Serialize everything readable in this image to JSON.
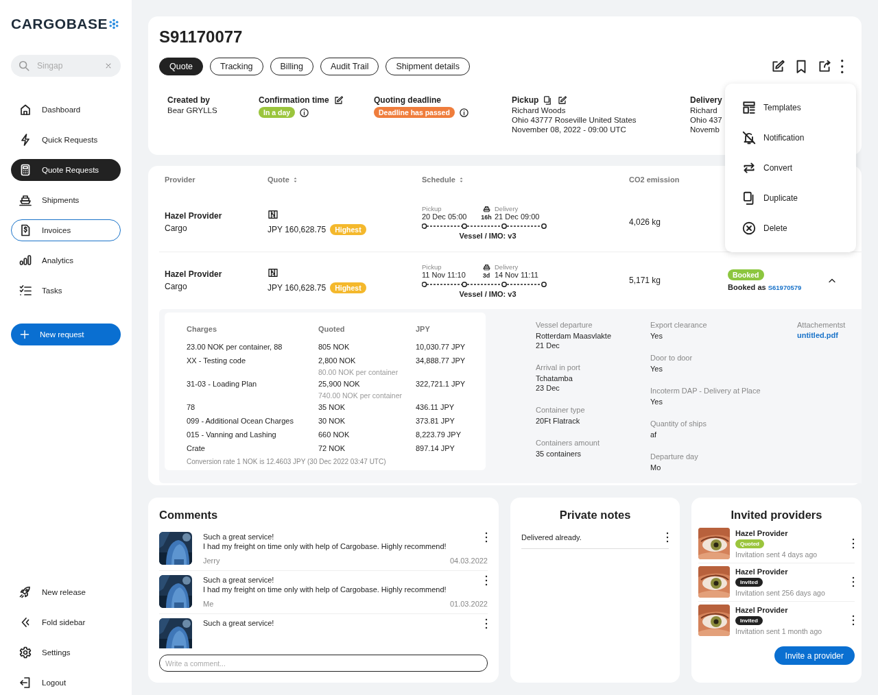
{
  "sidebar": {
    "logo": "CARGOBASE",
    "search": {
      "value": "Singap"
    },
    "items": [
      {
        "label": "Dashboard",
        "selected": false,
        "focused": false
      },
      {
        "label": "Quick Requests",
        "selected": false,
        "focused": false
      },
      {
        "label": "Quote Requests",
        "selected": true,
        "focused": false
      },
      {
        "label": "Shipments",
        "selected": false,
        "focused": false
      },
      {
        "label": "Invoices",
        "selected": false,
        "focused": true
      },
      {
        "label": "Analytics",
        "selected": false,
        "focused": false
      },
      {
        "label": "Tasks",
        "selected": false,
        "focused": false
      }
    ],
    "new_request": "New request",
    "bottom_items": [
      "New release",
      "Fold sidebar",
      "Settings",
      "Logout"
    ]
  },
  "header": {
    "title": "S91170077",
    "tabs": [
      {
        "label": "Quote",
        "selected": true
      },
      {
        "label": "Tracking",
        "selected": false
      },
      {
        "label": "Billing",
        "selected": false
      },
      {
        "label": "Audit Trail",
        "selected": false
      },
      {
        "label": "Shipment details",
        "selected": false
      }
    ],
    "fields": [
      {
        "label": "Created by",
        "lines": [
          "Bear GRYLLS"
        ]
      },
      {
        "label": "Confirmation time",
        "badge": {
          "text": "In a day",
          "color": "#9bc53d"
        }
      },
      {
        "label": "Quoting deadline",
        "badge": {
          "text": "Deadline has passed",
          "color": "#ef7d3c"
        }
      },
      {
        "label": "Pickup",
        "lines": [
          "Richard Woods",
          "Ohio 43777 Roseville United States",
          "November 08, 2022 - 09:00 UTC"
        ]
      },
      {
        "label": "Delivery",
        "lines": [
          "Richard",
          "Ohio 437",
          "Novemb"
        ]
      }
    ]
  },
  "menu": {
    "items": [
      "Templates",
      "Notification",
      "Convert",
      "Duplicate",
      "Delete"
    ]
  },
  "quotes": {
    "columns": [
      {
        "label": "Provider",
        "sortable": false
      },
      {
        "label": "Quote",
        "sortable": true
      },
      {
        "label": "Schedule",
        "sortable": true
      },
      {
        "label": "CO2 emission",
        "sortable": false
      }
    ],
    "rows": [
      {
        "provider": "Hazel Provider",
        "type": "Cargo",
        "price": "JPY 160,628.75",
        "badge": {
          "text": "Highest",
          "color": "#f4b82c"
        },
        "pickup_label": "Pickup",
        "pickup": "20 Dec 05:00",
        "duration": "16h",
        "delivery_label": "Delivery",
        "delivery": "21 Dec 09:00",
        "vessel": "Vessel / IMO: v3",
        "co2": "4,026 kg"
      },
      {
        "provider": "Hazel Provider",
        "type": "Cargo",
        "price": "JPY 160,628.75",
        "badge": {
          "text": "Highest",
          "color": "#f4b82c"
        },
        "pickup_label": "Pickup",
        "pickup": "11 Nov 11:10",
        "duration": "3d",
        "delivery_label": "Delivery",
        "delivery": "14 Nov 11:11",
        "vessel": "Vessel / IMO: v3",
        "co2": "5,171 kg",
        "status": {
          "badge": "Booked",
          "color": "#8cc63f",
          "label": "Booked as",
          "ref": "S61970579"
        },
        "expanded": true
      }
    ],
    "details": {
      "columns": [
        "Charges",
        "Quoted",
        "JPY"
      ],
      "charges": [
        {
          "charge": "23.00 NOK per container, 88",
          "quoted": "805 NOK",
          "jpy": "10,030.77 JPY"
        },
        {
          "charge": "XX - Testing code",
          "quoted": "2,800 NOK",
          "note": "80.00 NOK per container",
          "jpy": "34,888.77 JPY"
        },
        {
          "charge": "31-03 - Loading Plan",
          "quoted": "25,900 NOK",
          "note": "740.00 NOK per container",
          "jpy": "322,721.1 JPY"
        },
        {
          "charge": "78",
          "quoted": "35 NOK",
          "jpy": "436.11 JPY"
        },
        {
          "charge": "099 - Additional Ocean Charges",
          "quoted": "30 NOK",
          "jpy": "373.81 JPY"
        },
        {
          "charge": "015 - Vanning and Lashing",
          "quoted": "660 NOK",
          "jpy": "8,223.79 JPY"
        },
        {
          "charge": "Crate",
          "quoted": "72 NOK",
          "jpy": "897.14 JPY"
        }
      ],
      "conversion": "Conversion rate 1 NOK is 12.4603 JPY (30 Dec 2022 03:47 UTC)",
      "info_columns": [
        [
          {
            "label": "Vessel departure",
            "lines": [
              "Rotterdam Maasvlakte",
              "21 Dec"
            ]
          },
          {
            "label": "Arrival in port",
            "lines": [
              "Tchatamba",
              "23 Dec"
            ]
          },
          {
            "label": "Container type",
            "lines": [
              "20Ft Flatrack"
            ]
          },
          {
            "label": "Containers amount",
            "lines": [
              "35 containers"
            ]
          }
        ],
        [
          {
            "label": "Export clearance",
            "lines": [
              "Yes"
            ]
          },
          {
            "label": "Door to door",
            "lines": [
              "Yes"
            ]
          },
          {
            "label": "Incoterm DAP - Delivery at Place",
            "lines": [
              "Yes"
            ]
          },
          {
            "label": "Quantity of ships",
            "lines": [
              "af"
            ]
          },
          {
            "label": "Departure day",
            "lines": [
              "Mo"
            ]
          }
        ]
      ],
      "attachments": {
        "label": "Attachementst",
        "files": [
          "untitled.pdf"
        ]
      }
    }
  },
  "comments": {
    "title": "Comments",
    "items": [
      {
        "title": "Such a great service!",
        "message": "I had my freight on time only with help of Cargobase. Highly recommend!",
        "author": "Jerry",
        "date": "04.03.2022"
      },
      {
        "title": "Such a great service!",
        "message": "I had my freight on time only with help of Cargobase. Highly recommend!",
        "author": "Me",
        "date": "01.03.2022"
      },
      {
        "title": "Such a great service!"
      }
    ],
    "placeholder": "Write a comment..."
  },
  "notes": {
    "title": "Private notes",
    "items": [
      "Delivered already."
    ]
  },
  "providers": {
    "title": "Invited providers",
    "items": [
      {
        "name": "Hazel Provider",
        "status": "Quoted",
        "color": "#9bc53d",
        "sent": "Invitation sent 4 days ago"
      },
      {
        "name": "Hazel Provider",
        "status": "Invited",
        "color": "#222222",
        "sent": "Invitation sent 256 days ago"
      },
      {
        "name": "Hazel Provider",
        "status": "Invited",
        "color": "#222222",
        "sent": "Invitation sent 1 month ago"
      }
    ],
    "button": "Invite a provider"
  }
}
